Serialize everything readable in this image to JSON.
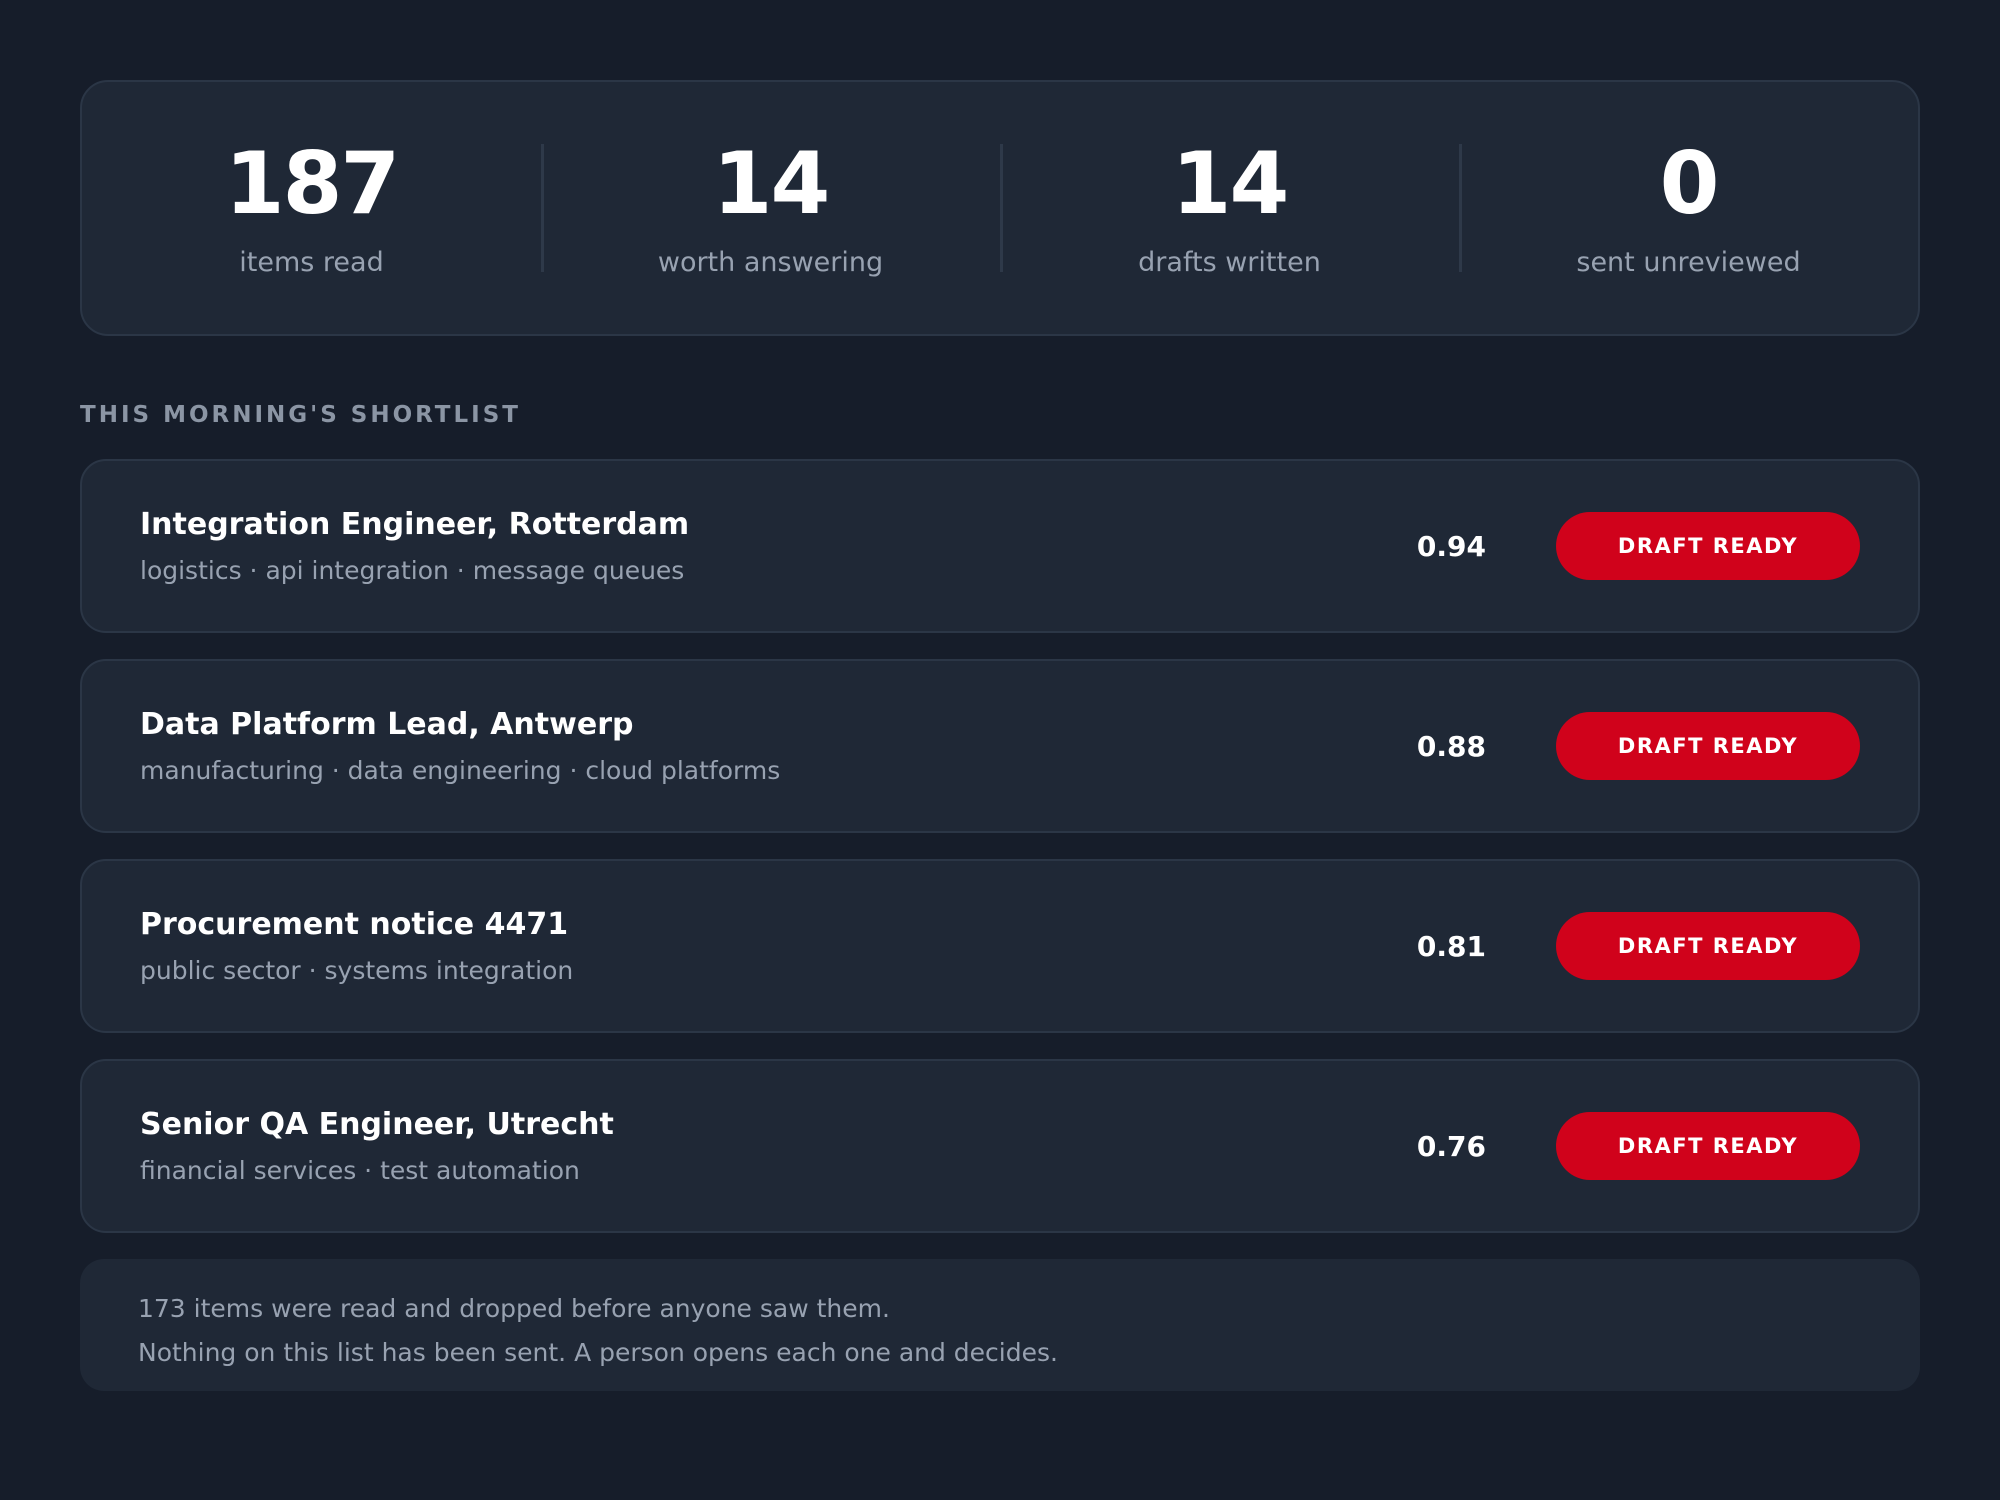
{
  "stats": [
    {
      "value": "187",
      "label": "items read"
    },
    {
      "value": "14",
      "label": "worth answering"
    },
    {
      "value": "14",
      "label": "drafts written"
    },
    {
      "value": "0",
      "label": "sent unreviewed"
    }
  ],
  "shortlist": {
    "heading": "THIS MORNING'S SHORTLIST",
    "items": [
      {
        "title": "Integration Engineer, Rotterdam",
        "tags": "logistics · api integration · message queues",
        "score": "0.94",
        "status": "DRAFT READY"
      },
      {
        "title": "Data Platform Lead, Antwerp",
        "tags": "manufacturing · data engineering · cloud platforms",
        "score": "0.88",
        "status": "DRAFT READY"
      },
      {
        "title": "Procurement notice 4471",
        "tags": "public sector · systems integration",
        "score": "0.81",
        "status": "DRAFT READY"
      },
      {
        "title": "Senior QA Engineer, Utrecht",
        "tags": "financial services · test automation",
        "score": "0.76",
        "status": "DRAFT READY"
      }
    ]
  },
  "note": {
    "line1": "173 items were read and dropped before anyone saw them.",
    "line2": "Nothing on this list has been sent. A person opens each one and decides."
  },
  "colors": {
    "background": "#161d2a",
    "panel": "#1f2836",
    "accent": "#d0021b",
    "muted_text": "#98a2b1"
  }
}
